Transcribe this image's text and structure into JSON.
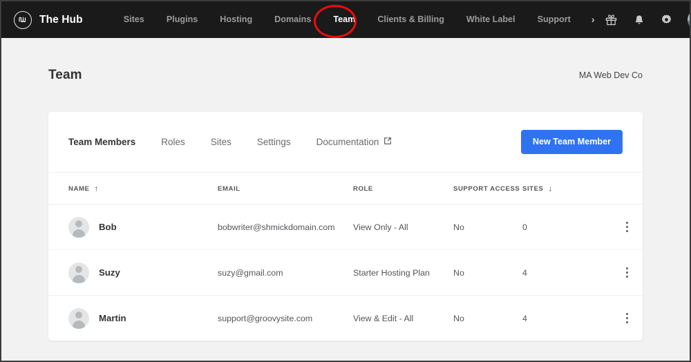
{
  "topbar": {
    "logo_icon": "hub-circle-logo-icon",
    "brand": "The Hub",
    "nav": [
      {
        "label": "Sites",
        "active": false
      },
      {
        "label": "Plugins",
        "active": false
      },
      {
        "label": "Hosting",
        "active": false
      },
      {
        "label": "Domains",
        "active": false
      },
      {
        "label": "Team",
        "active": true
      },
      {
        "label": "Clients & Billing",
        "active": false
      },
      {
        "label": "White Label",
        "active": false
      },
      {
        "label": "Support",
        "active": false
      }
    ],
    "overflow_chevron": "›",
    "icons": [
      "gift-icon",
      "bell-icon",
      "gear-icon"
    ],
    "avatar": "user-avatar",
    "annotation_color": "#f00b0b",
    "annotation_target": "Team"
  },
  "page": {
    "title": "Team",
    "account": "MA Web Dev Co"
  },
  "card": {
    "tabs": [
      {
        "label": "Team Members",
        "active": true,
        "external": false
      },
      {
        "label": "Roles",
        "active": false,
        "external": false
      },
      {
        "label": "Sites",
        "active": false,
        "external": false
      },
      {
        "label": "Settings",
        "active": false,
        "external": false
      },
      {
        "label": "Documentation",
        "active": false,
        "external": true
      }
    ],
    "primary_button": "New Team Member",
    "primary_button_color": "#2f73f2"
  },
  "table": {
    "columns": [
      {
        "label": "NAME",
        "sort": "asc"
      },
      {
        "label": "EMAIL",
        "sort": null
      },
      {
        "label": "ROLE",
        "sort": null
      },
      {
        "label": "SUPPORT ACCESS",
        "sort": null
      },
      {
        "label": "SITES",
        "sort": "desc"
      },
      {
        "label": "",
        "sort": null
      }
    ],
    "sort_asc_glyph": "↑",
    "sort_desc_glyph": "↓",
    "rows": [
      {
        "name": "Bob",
        "email": "bobwriter@shmickdomain.com",
        "role": "View Only - All",
        "support_access": "No",
        "sites": "0",
        "menu": "row-actions-menu"
      },
      {
        "name": "Suzy",
        "email": "suzy@gmail.com",
        "role": "Starter Hosting Plan",
        "support_access": "No",
        "sites": "4",
        "menu": "row-actions-menu"
      },
      {
        "name": "Martin",
        "email": "support@groovysite.com",
        "role": "View & Edit - All",
        "support_access": "No",
        "sites": "4",
        "menu": "row-actions-menu"
      }
    ]
  }
}
